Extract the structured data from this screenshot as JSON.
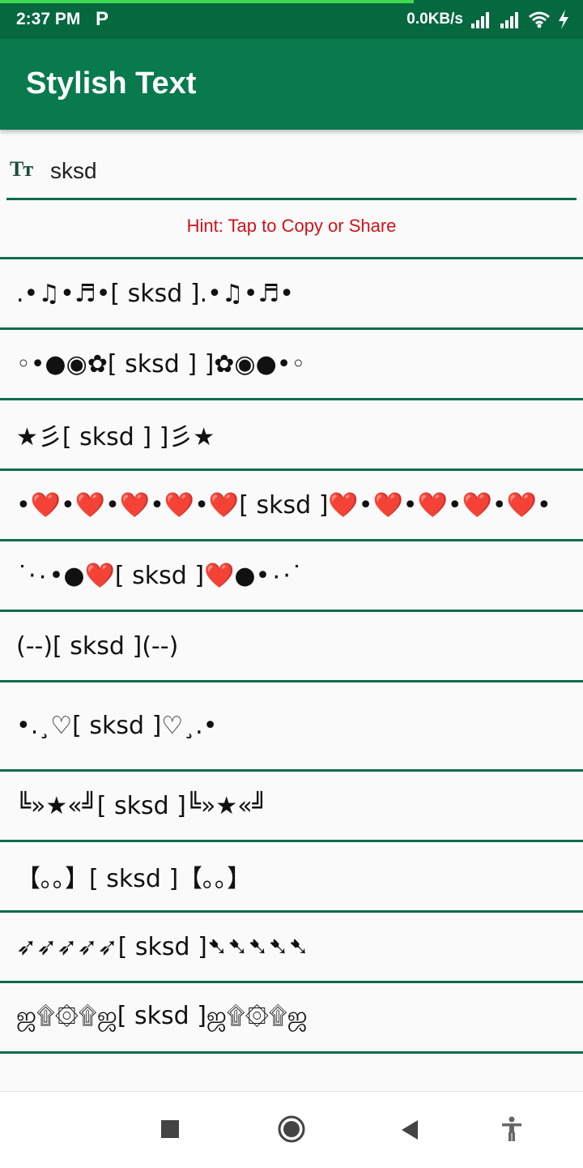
{
  "status_bar": {
    "time": "2:37 PM",
    "notification_glyph": "P",
    "network_speed": "0.0KB/s",
    "icons": [
      "signal-icon",
      "signal-icon",
      "wifi-icon",
      "charging-bolt-icon"
    ],
    "progress": 0.71
  },
  "app_bar": {
    "title": "Stylish Text"
  },
  "input": {
    "value": "sksd",
    "icon": "text-size-icon",
    "icon_text": "Tт"
  },
  "hint": "Hint: Tap to Copy or Share",
  "styles": [
    {
      "text": ".•♫•♬•[ sksd ].•♫•♬•"
    },
    {
      "text": "◦•●◉✿[ sksd ] ]✿◉●•◦"
    },
    {
      "text": "★彡[ sksd ] ]彡★"
    },
    {
      "text": "•❤️•❤️•❤️•❤️•❤️[ sksd ]❤️•❤️•❤️•❤️•❤️•"
    },
    {
      "text": "˙·٠•●❤️[ sksd ]❤️●•٠·˙"
    },
    {
      "text": "(--)[ sksd ](--)"
    },
    {
      "text": " •.¸♡[ sksd ]♡¸.•"
    },
    {
      "text": "╚»★«╝[ sksd ]╚»★«╝"
    },
    {
      "text": "【｡｡】[ sksd ]【｡｡】"
    },
    {
      "text": "➶➶➶➶➶[ sksd ]➷➷➷➷➷"
    },
    {
      "text": "ஜ۩۞۩ஜ[ sksd ]ஜ۩۞۩ஜ"
    }
  ],
  "nav_bar": {
    "buttons": [
      "recents-square-icon",
      "home-circle-icon",
      "back-triangle-icon",
      "accessibility-icon"
    ]
  },
  "colors": {
    "status_bar": "#06683f",
    "app_bar": "#087a4e",
    "divider": "#0f6b4c",
    "hint": "#d0121b"
  }
}
